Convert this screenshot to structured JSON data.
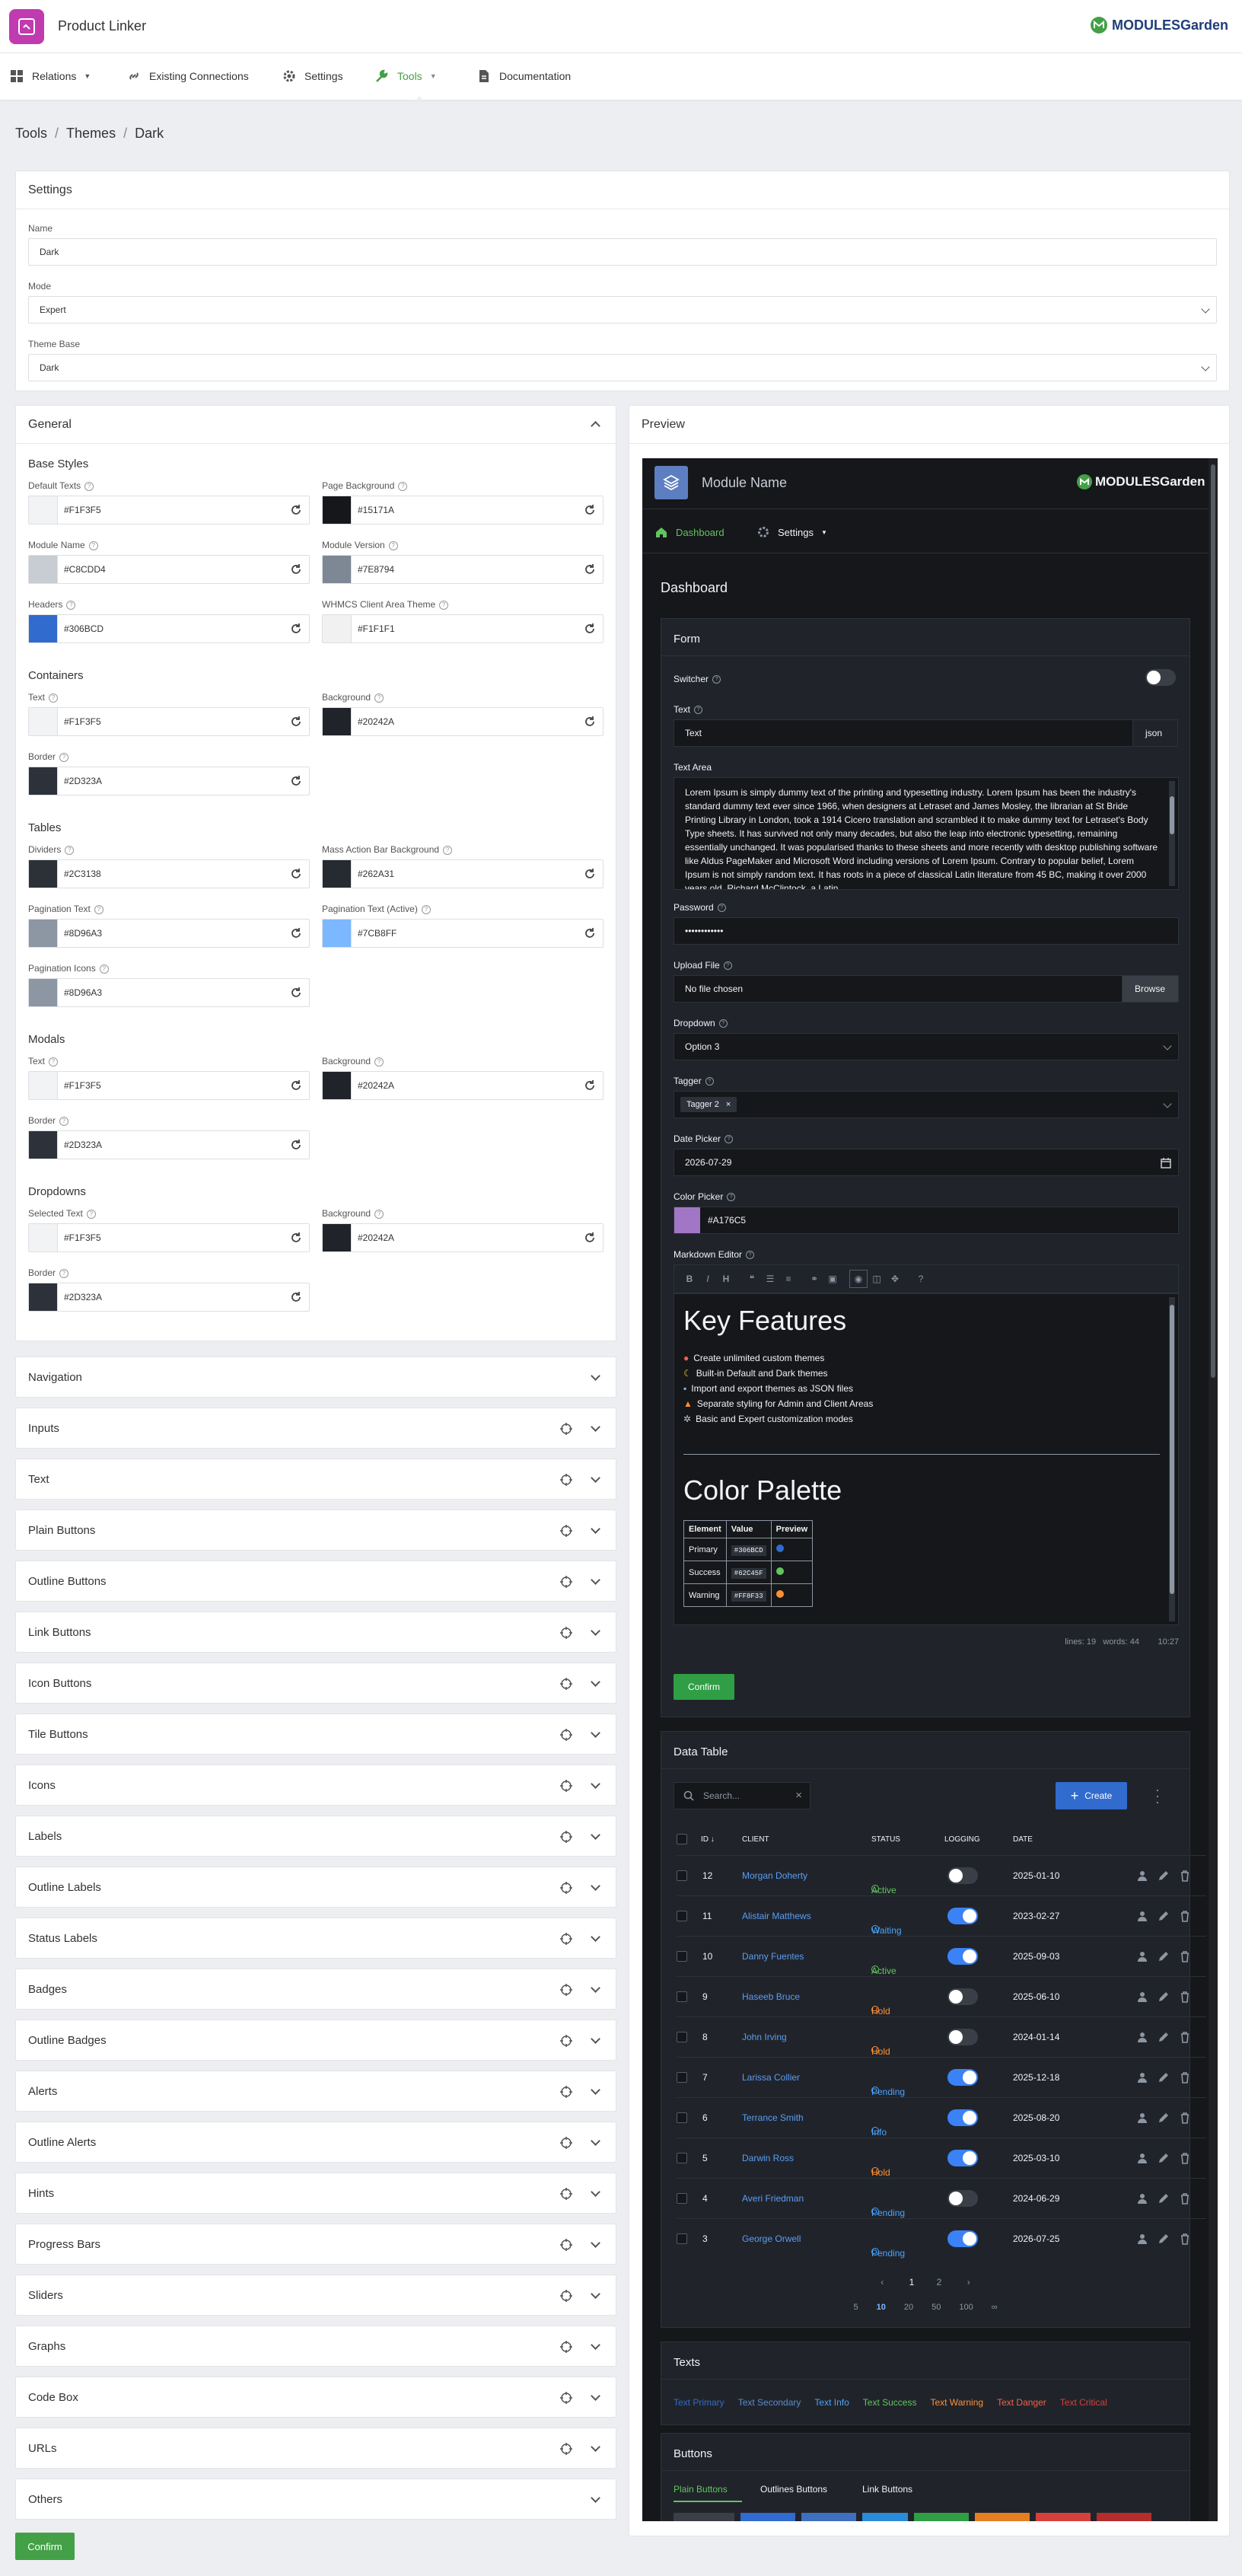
{
  "app": {
    "title": "Product Linker",
    "vendor_logo": "MODULESGarden"
  },
  "nav": [
    {
      "label": "Relations",
      "icon": "grid-icon",
      "dropdown": true
    },
    {
      "label": "Existing Connections",
      "icon": "link-icon",
      "dropdown": false
    },
    {
      "label": "Settings",
      "icon": "gear-icon",
      "dropdown": false
    },
    {
      "label": "Tools",
      "icon": "wrench-icon",
      "dropdown": true,
      "active": true
    },
    {
      "label": "Documentation",
      "icon": "document-icon",
      "dropdown": false
    }
  ],
  "breadcrumb": [
    "Tools",
    "Themes",
    "Dark"
  ],
  "settings": {
    "title": "Settings",
    "name_label": "Name",
    "name_value": "Dark",
    "mode_label": "Mode",
    "mode_value": "Expert",
    "base_label": "Theme Base",
    "base_value": "Dark"
  },
  "general": {
    "title": "General",
    "sections": [
      {
        "title": "Base Styles",
        "fields": [
          {
            "label": "Default Texts",
            "hex": "#F1F3F5"
          },
          {
            "label": "Page Background",
            "hex": "#15171A"
          },
          {
            "label": "Module Name",
            "hex": "#C8CDD4"
          },
          {
            "label": "Module Version",
            "hex": "#7E8794"
          },
          {
            "label": "Headers",
            "hex": "#306BCD"
          },
          {
            "label": "WHMCS Client Area Theme",
            "hex": "#F1F1F1"
          }
        ]
      },
      {
        "title": "Containers",
        "fields": [
          {
            "label": "Text",
            "hex": "#F1F3F5"
          },
          {
            "label": "Background",
            "hex": "#20242A"
          },
          {
            "label": "Border",
            "hex": "#2D323A"
          }
        ]
      },
      {
        "title": "Tables",
        "fields": [
          {
            "label": "Dividers",
            "hex": "#2C3138"
          },
          {
            "label": "Mass Action Bar Background",
            "hex": "#262A31"
          },
          {
            "label": "Pagination Text",
            "hex": "#8D96A3"
          },
          {
            "label": "Pagination Text (Active)",
            "hex": "#7CB8FF"
          },
          {
            "label": "Pagination Icons",
            "hex": "#8D96A3"
          }
        ]
      },
      {
        "title": "Modals",
        "fields": [
          {
            "label": "Text",
            "hex": "#F1F3F5"
          },
          {
            "label": "Background",
            "hex": "#20242A"
          },
          {
            "label": "Border",
            "hex": "#2D323A"
          }
        ]
      },
      {
        "title": "Dropdowns",
        "fields": [
          {
            "label": "Selected Text",
            "hex": "#F1F3F5"
          },
          {
            "label": "Background",
            "hex": "#20242A"
          },
          {
            "label": "Border",
            "hex": "#2D323A"
          }
        ]
      }
    ]
  },
  "accordions": [
    {
      "label": "Navigation",
      "crosshair": false
    },
    {
      "label": "Inputs",
      "crosshair": true
    },
    {
      "label": "Text",
      "crosshair": true
    },
    {
      "label": "Plain Buttons",
      "crosshair": true
    },
    {
      "label": "Outline Buttons",
      "crosshair": true
    },
    {
      "label": "Link Buttons",
      "crosshair": true
    },
    {
      "label": "Icon Buttons",
      "crosshair": true
    },
    {
      "label": "Tile Buttons",
      "crosshair": true
    },
    {
      "label": "Icons",
      "crosshair": true
    },
    {
      "label": "Labels",
      "crosshair": true
    },
    {
      "label": "Outline Labels",
      "crosshair": true
    },
    {
      "label": "Status Labels",
      "crosshair": true
    },
    {
      "label": "Badges",
      "crosshair": true
    },
    {
      "label": "Outline Badges",
      "crosshair": true
    },
    {
      "label": "Alerts",
      "crosshair": true
    },
    {
      "label": "Outline Alerts",
      "crosshair": true
    },
    {
      "label": "Hints",
      "crosshair": true
    },
    {
      "label": "Progress Bars",
      "crosshair": true
    },
    {
      "label": "Sliders",
      "crosshair": true
    },
    {
      "label": "Graphs",
      "crosshair": true
    },
    {
      "label": "Code Box",
      "crosshair": true
    },
    {
      "label": "URLs",
      "crosshair": true
    },
    {
      "label": "Others",
      "crosshair": false
    }
  ],
  "confirm_label": "Confirm",
  "preview": {
    "title": "Preview",
    "module_name": "Module Name",
    "logo": "MODULESGarden",
    "nav_dashboard": "Dashboard",
    "nav_settings": "Settings",
    "page_title": "Dashboard",
    "form": {
      "title": "Form",
      "switcher_label": "Switcher",
      "text_label": "Text",
      "text_value": "Text",
      "text_addon": "json",
      "textarea_label": "Text Area",
      "textarea_value": "Lorem Ipsum is simply dummy text of the printing and typesetting industry. Lorem Ipsum has been the industry's standard dummy text ever since 1966, when designers at Letraset and James Mosley, the librarian at St Bride Printing Library in London, took a 1914 Cicero translation and scrambled it to make dummy text for Letraset's Body Type sheets. It has survived not only many decades, but also the leap into electronic typesetting, remaining essentially unchanged. It was popularised thanks to these sheets and more recently with desktop publishing software like Aldus PageMaker and Microsoft Word including versions of Lorem Ipsum. Contrary to popular belief, Lorem Ipsum is not simply random text. It has roots in a piece of classical Latin literature from 45 BC, making it over 2000 years old. Richard McClintock, a Latin",
      "password_label": "Password",
      "password_value": "••••••••••••",
      "upload_label": "Upload File",
      "upload_value": "No file chosen",
      "browse_label": "Browse",
      "dropdown_label": "Dropdown",
      "dropdown_value": "Option 3",
      "tagger_label": "Tagger",
      "tagger_value": "Tagger 2",
      "date_label": "Date Picker",
      "date_value": "2026-07-29",
      "color_label": "Color Picker",
      "color_value": "#A176C5",
      "md_label": "Markdown Editor",
      "md_heading1": "Key Features",
      "md_items": [
        "Create unlimited custom themes",
        "Built-in Default and Dark themes",
        "Import and export themes as JSON files",
        "Separate styling for Admin and Client Areas",
        "Basic and Expert customization modes"
      ],
      "md_heading2": "Color Palette",
      "md_table_headers": [
        "Element",
        "Value",
        "Preview"
      ],
      "md_table_rows": [
        {
          "element": "Primary",
          "value": "#306BCD",
          "color": "#306BCD"
        },
        {
          "element": "Success",
          "value": "#62C45F",
          "color": "#62C45F"
        },
        {
          "element": "Warning",
          "value": "#FF8F33",
          "color": "#FF8F33"
        }
      ],
      "md_status": "lines: 19   words: 44        10:27",
      "confirm_label": "Confirm"
    },
    "table": {
      "title": "Data Table",
      "search_placeholder": "Search...",
      "create_label": "Create",
      "headers": [
        "ID",
        "CLIENT",
        "STATUS",
        "LOGGING",
        "DATE"
      ],
      "rows": [
        {
          "id": "12",
          "client": "Morgan Doherty",
          "status": "Active",
          "logging": false,
          "date": "2025-01-10"
        },
        {
          "id": "11",
          "client": "Alistair Matthews",
          "status": "Waiting",
          "logging": true,
          "date": "2023-02-27"
        },
        {
          "id": "10",
          "client": "Danny Fuentes",
          "status": "Active",
          "logging": true,
          "date": "2025-09-03"
        },
        {
          "id": "9",
          "client": "Haseeb Bruce",
          "status": "Hold",
          "logging": false,
          "date": "2025-06-10"
        },
        {
          "id": "8",
          "client": "John Irving",
          "status": "Hold",
          "logging": false,
          "date": "2024-01-14"
        },
        {
          "id": "7",
          "client": "Larissa Collier",
          "status": "Pending",
          "logging": true,
          "date": "2025-12-18"
        },
        {
          "id": "6",
          "client": "Terrance Smith",
          "status": "Info",
          "logging": true,
          "date": "2025-08-20"
        },
        {
          "id": "5",
          "client": "Darwin Ross",
          "status": "Hold",
          "logging": true,
          "date": "2025-03-10"
        },
        {
          "id": "4",
          "client": "Averi Friedman",
          "status": "Pending",
          "logging": false,
          "date": "2024-06-29"
        },
        {
          "id": "3",
          "client": "George Orwell",
          "status": "Pending",
          "logging": true,
          "date": "2026-07-25"
        }
      ],
      "pages": [
        "1",
        "2"
      ],
      "page_sizes": [
        "5",
        "10",
        "20",
        "50",
        "100",
        "∞"
      ],
      "active_page_size": "10"
    },
    "texts": {
      "title": "Texts",
      "items": [
        {
          "label": "Text Primary",
          "color": "#306BCD"
        },
        {
          "label": "Text Secondary",
          "color": "#5b8bd0"
        },
        {
          "label": "Text Info",
          "color": "#4aa3ff"
        },
        {
          "label": "Text Success",
          "color": "#62C45F"
        },
        {
          "label": "Text Warning",
          "color": "#FF8F33"
        },
        {
          "label": "Text Danger",
          "color": "#f0624a"
        },
        {
          "label": "Text Critical",
          "color": "#d6403a"
        }
      ]
    },
    "buttons": {
      "title": "Buttons",
      "tabs": [
        "Plain Buttons",
        "Outlines Buttons",
        "Link Buttons"
      ]
    }
  },
  "colors": {
    "accent": "#43a047",
    "link": "#5a9cf5",
    "dark_bg": "#15171A",
    "dark_panel": "#20242A"
  },
  "status_colors": {
    "Active": "#62C45F",
    "Waiting": "#4aa3ff",
    "Hold": "#FF8F33",
    "Pending": "#4aa3ff",
    "Info": "#4aa3ff"
  }
}
